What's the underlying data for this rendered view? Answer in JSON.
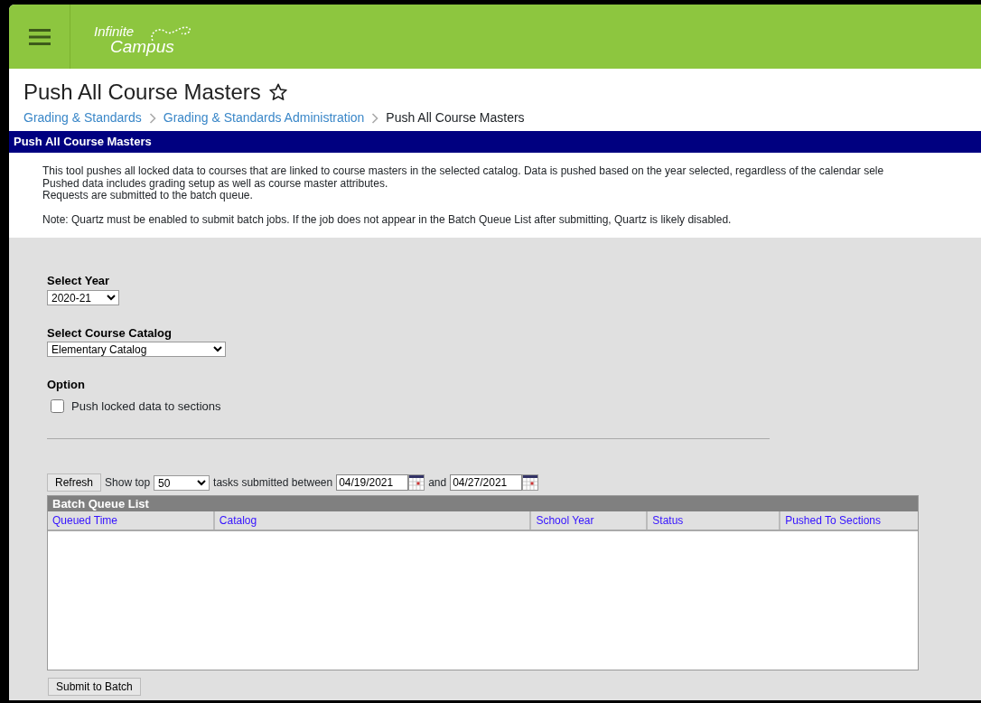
{
  "header": {
    "logo": {
      "line1": "Infinite",
      "line2": "Campus"
    }
  },
  "page": {
    "title": "Push All Course Masters",
    "favorite": false
  },
  "breadcrumbs": [
    {
      "label": "Grading & Standards",
      "link": true
    },
    {
      "label": "Grading & Standards Administration",
      "link": true
    },
    {
      "label": "Push All Course Masters",
      "link": false
    }
  ],
  "panel": {
    "title": "Push All Course Masters",
    "intro": [
      "This tool pushes all locked data to courses that are linked to course masters in the selected catalog. Data is pushed based on the year selected, regardless of the calendar sele",
      "Pushed data includes grading setup as well as course master attributes.",
      "Requests are submitted to the batch queue."
    ],
    "note": "Note: Quartz must be enabled to submit batch jobs. If the job does not appear in the Batch Queue List after submitting, Quartz is likely disabled."
  },
  "form": {
    "year": {
      "label": "Select Year",
      "value": "2020-21"
    },
    "catalog": {
      "label": "Select Course Catalog",
      "value": "Elementary Catalog"
    },
    "option": {
      "label": "Option",
      "checkbox": {
        "label": "Push locked data to sections",
        "checked": false
      }
    }
  },
  "batch": {
    "refresh": "Refresh",
    "show_top": "Show top",
    "count": "50",
    "between": "tasks submitted between",
    "start": "04/19/2021",
    "and": "and",
    "end": "04/27/2021",
    "list_title": "Batch Queue List",
    "columns": [
      "Queued Time",
      "Catalog",
      "School Year",
      "Status",
      "Pushed To Sections"
    ]
  },
  "submit": "Submit to Batch"
}
